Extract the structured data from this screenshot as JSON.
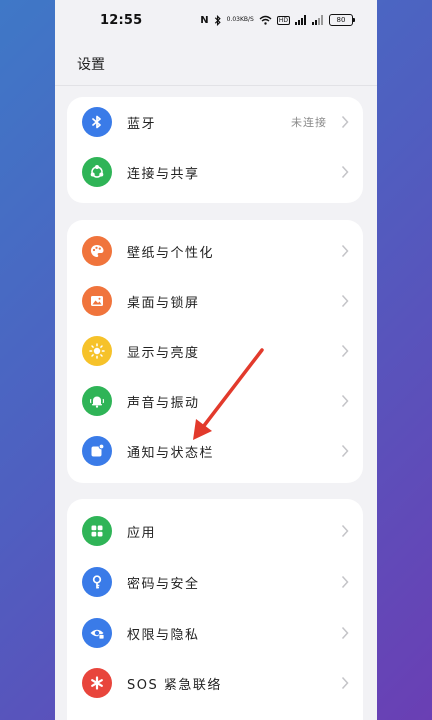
{
  "status_bar": {
    "time": "12:55",
    "nfc": "N",
    "speed_top": "0.03",
    "speed_bottom": "KB/S",
    "hd": "HD",
    "battery": "80"
  },
  "header": {
    "title": "设置"
  },
  "groups": [
    {
      "items": [
        {
          "label": "蓝牙",
          "value": "未连接",
          "icon": "bluetooth-icon",
          "color": "#3a7be8"
        },
        {
          "label": "连接与共享",
          "icon": "share-icon",
          "color": "#2fb457"
        }
      ]
    },
    {
      "items": [
        {
          "label": "壁纸与个性化",
          "icon": "palette-icon",
          "color": "#f0743c"
        },
        {
          "label": "桌面与锁屏",
          "icon": "image-icon",
          "color": "#f0743c"
        },
        {
          "label": "显示与亮度",
          "icon": "sun-icon",
          "color": "#f6c22a"
        },
        {
          "label": "声音与振动",
          "icon": "bell-icon",
          "color": "#2fb457"
        },
        {
          "label": "通知与状态栏",
          "icon": "notification-icon",
          "color": "#3a7be8"
        }
      ]
    },
    {
      "items": [
        {
          "label": "应用",
          "icon": "apps-icon",
          "color": "#2fb457"
        },
        {
          "label": "密码与安全",
          "icon": "key-icon",
          "color": "#3a7be8"
        },
        {
          "label": "权限与隐私",
          "icon": "privacy-icon",
          "color": "#3a7be8"
        },
        {
          "label": "SOS 紧急联络",
          "icon": "sos-icon",
          "color": "#e8453c"
        }
      ]
    }
  ],
  "annotation": {
    "arrow_color": "#e23a2c"
  }
}
